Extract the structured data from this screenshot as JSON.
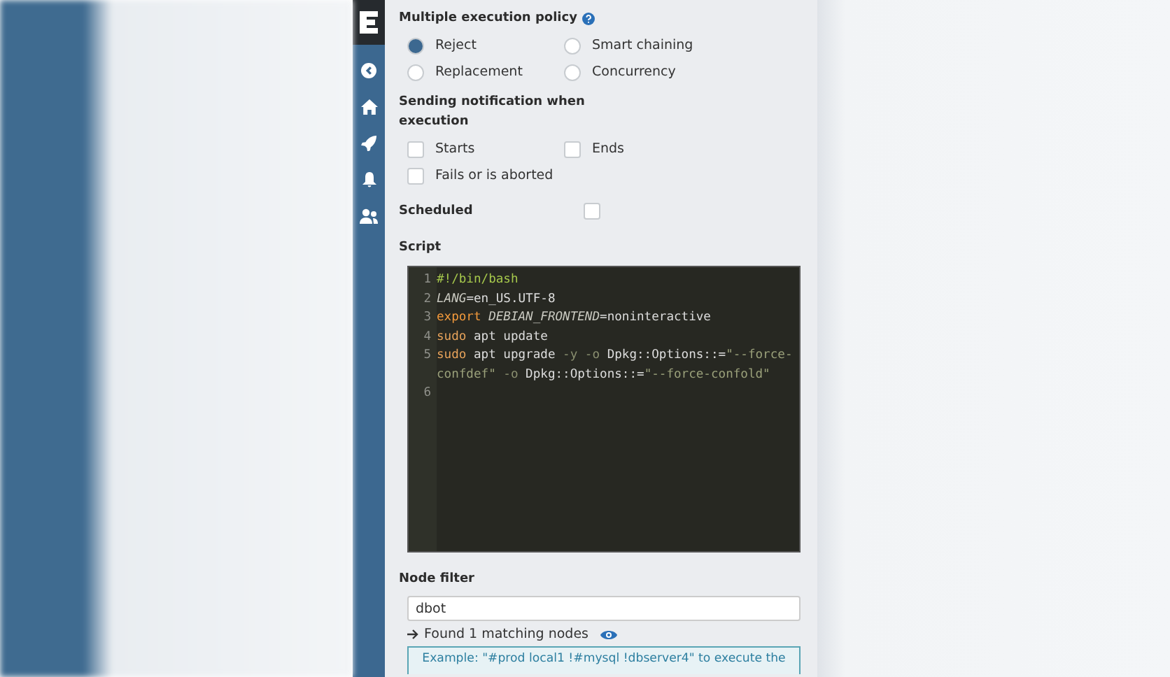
{
  "sidebar": {
    "items": [
      {
        "kind": "back"
      },
      {
        "kind": "home"
      },
      {
        "kind": "rocket"
      },
      {
        "kind": "bell"
      },
      {
        "kind": "users"
      }
    ]
  },
  "policy": {
    "label": "Multiple execution policy",
    "options": [
      {
        "label": "Reject",
        "selected": true
      },
      {
        "label": "Smart chaining",
        "selected": false
      },
      {
        "label": "Replacement",
        "selected": false
      },
      {
        "label": "Concurrency",
        "selected": false
      }
    ]
  },
  "notification": {
    "label": "Sending notification when execution",
    "options": [
      {
        "label": "Starts",
        "checked": false
      },
      {
        "label": "Ends",
        "checked": false
      },
      {
        "label": "Fails or is aborted",
        "checked": false
      }
    ]
  },
  "scheduled": {
    "label": "Scheduled",
    "checked": false
  },
  "script": {
    "label": "Script",
    "lines": [
      {
        "number": "1",
        "tokens": [
          {
            "kind": "comment",
            "text": "#!/bin/bash"
          }
        ]
      },
      {
        "number": "2",
        "tokens": [
          {
            "kind": "variable",
            "text": "LANG"
          },
          {
            "kind": "plain",
            "text": "=en_US.UTF-8"
          }
        ]
      },
      {
        "number": "3",
        "tokens": [
          {
            "kind": "keyword",
            "text": "export"
          },
          {
            "kind": "variable",
            "text": " DEBIAN_FRONTEND"
          },
          {
            "kind": "plain",
            "text": "=noninteractive"
          }
        ]
      },
      {
        "number": "4",
        "tokens": [
          {
            "kind": "builtin",
            "text": "sudo"
          },
          {
            "kind": "plain",
            "text": " apt update"
          }
        ]
      },
      {
        "number": "5",
        "tokens": [
          {
            "kind": "builtin",
            "text": "sudo"
          },
          {
            "kind": "plain",
            "text": " apt upgrade "
          },
          {
            "kind": "option",
            "text": "-y -o"
          },
          {
            "kind": "plain",
            "text": " Dpkg::Options::="
          },
          {
            "kind": "string",
            "text": "\"--force-confdef\""
          },
          {
            "kind": "option",
            "text": " -o"
          },
          {
            "kind": "plain",
            "text": " Dpkg::Options::="
          },
          {
            "kind": "string",
            "text": "\"--force-confold\""
          }
        ]
      },
      {
        "number": "6"
      }
    ]
  },
  "node_filter": {
    "label": "Node filter",
    "value": "dbot",
    "result": "Found 1 matching nodes",
    "example": "Example: \"#prod local1 !#mysql !dbserver4\" to execute the"
  }
}
